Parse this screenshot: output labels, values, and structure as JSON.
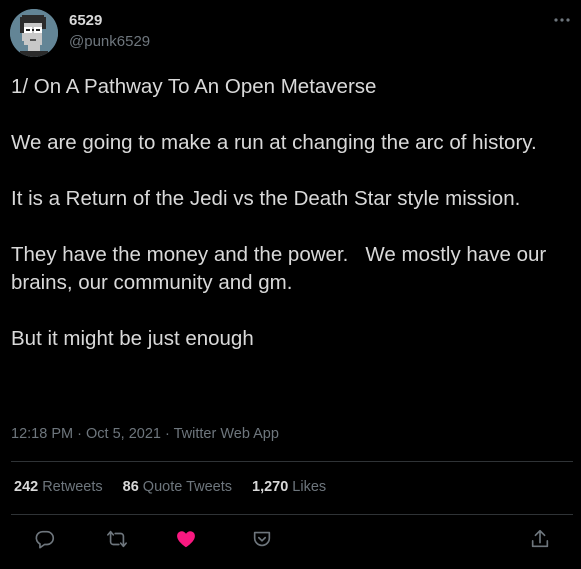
{
  "author": {
    "display_name": "6529",
    "handle": "@punk6529",
    "avatar_icon": "cryptopunk-avatar"
  },
  "tweet": {
    "paragraphs": [
      "1/ On A Pathway To An Open Metaverse",
      "We are going to make a run at changing the arc of history.",
      "It is a Return of the Jedi vs the Death Star style mission.",
      "They have the money and the power.   We mostly have our brains, our community and gm.",
      "But it might be just enough"
    ],
    "time": "12:18 PM",
    "date": "Oct 5, 2021",
    "separator": "·",
    "source": "Twitter Web App"
  },
  "stats": {
    "retweets": {
      "count": "242",
      "label": "Retweets"
    },
    "quote_tweets": {
      "count": "86",
      "label": "Quote Tweets"
    },
    "likes": {
      "count": "1,270",
      "label": "Likes"
    }
  },
  "actions": [
    "reply-icon",
    "retweet-icon",
    "like-icon",
    "bookmark-icon",
    "share-icon"
  ],
  "colors": {
    "background": "#000000",
    "text": "#d9d9d9",
    "secondary": "#6e767d",
    "divider": "#2f3336",
    "like": "#f91880"
  }
}
